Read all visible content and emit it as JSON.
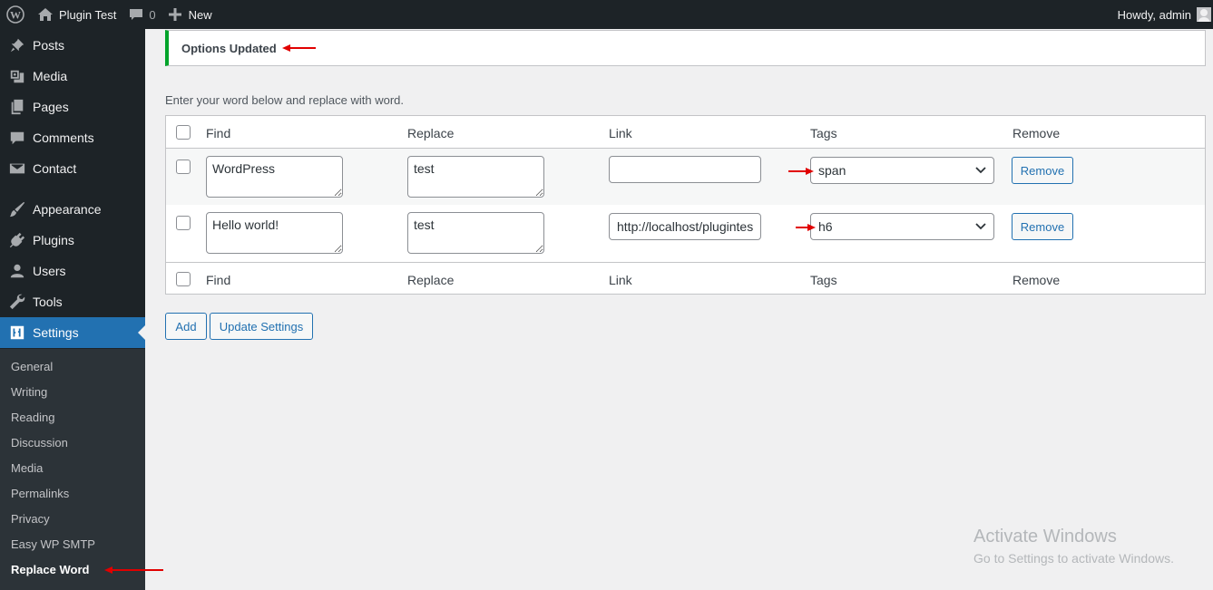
{
  "adminbar": {
    "site_name": "Plugin Test",
    "comments_count": "0",
    "new_label": "New",
    "greeting": "Howdy, admin"
  },
  "sidebar": {
    "items": [
      {
        "label": "Posts",
        "icon": "pin-icon"
      },
      {
        "label": "Media",
        "icon": "media-icon"
      },
      {
        "label": "Pages",
        "icon": "pages-icon"
      },
      {
        "label": "Comments",
        "icon": "comments-icon"
      },
      {
        "label": "Contact",
        "icon": "mail-icon"
      },
      {
        "label": "Appearance",
        "icon": "brush-icon"
      },
      {
        "label": "Plugins",
        "icon": "plugin-icon"
      },
      {
        "label": "Users",
        "icon": "users-icon"
      },
      {
        "label": "Tools",
        "icon": "wrench-icon"
      },
      {
        "label": "Settings",
        "icon": "settings-icon"
      }
    ],
    "submenu": [
      "General",
      "Writing",
      "Reading",
      "Discussion",
      "Media",
      "Permalinks",
      "Privacy",
      "Easy WP SMTP",
      "Replace Word"
    ]
  },
  "notice": {
    "text": "Options Updated"
  },
  "intro": "Enter your word below and replace with word.",
  "table": {
    "headers": [
      "Find",
      "Replace",
      "Link",
      "Tags",
      "Remove"
    ],
    "rows": [
      {
        "find": "WordPress",
        "replace": "test",
        "link": "",
        "tag": "span",
        "remove": "Remove"
      },
      {
        "find": "Hello world!",
        "replace": "test",
        "link": "http://localhost/plugintest",
        "tag": "h6",
        "remove": "Remove"
      }
    ]
  },
  "buttons": {
    "add": "Add",
    "update": "Update Settings"
  },
  "watermark": {
    "title": "Activate Windows",
    "subtitle": "Go to Settings to activate Windows."
  },
  "colors": {
    "accent": "#2271b1",
    "sidebar": "#1d2327",
    "submenu": "#2c3338",
    "notice_success": "#00a32a",
    "annotation_arrow": "#e10000"
  }
}
